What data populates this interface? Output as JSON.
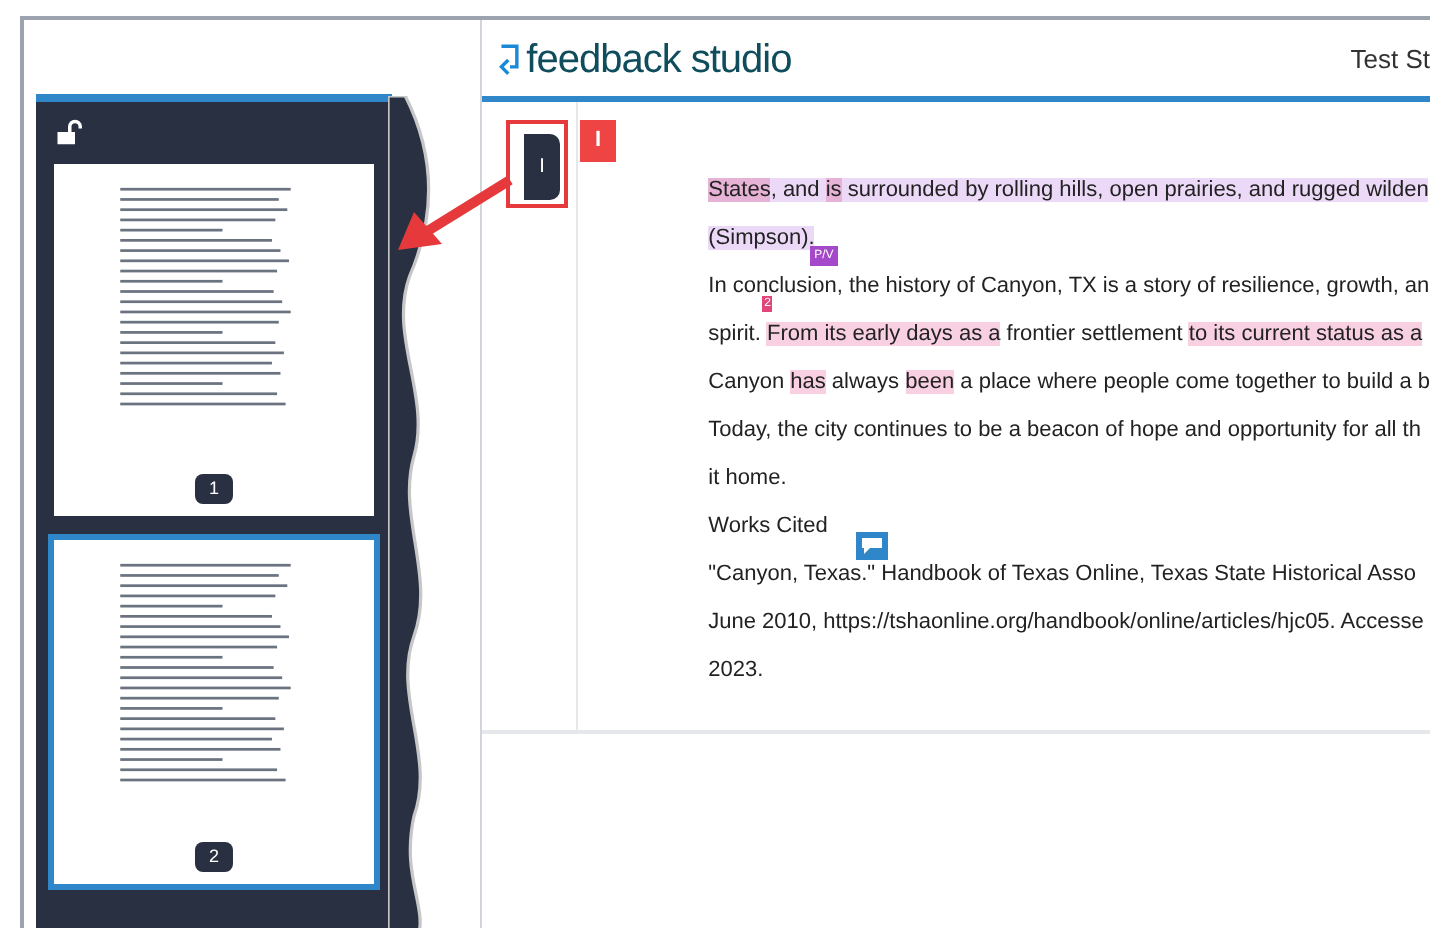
{
  "sidebar": {
    "pages": [
      {
        "label": "1",
        "selected": false
      },
      {
        "label": "2",
        "selected": true
      }
    ]
  },
  "header": {
    "logo": "feedback studio",
    "title": "Test St"
  },
  "handle": {
    "label": "I"
  },
  "callout": {
    "label": "I"
  },
  "document": {
    "lines": [
      {
        "segments": [
          {
            "text": "States",
            "color": "#e6b3d6"
          },
          {
            "text": ", and ",
            "color": "#ecd9f7"
          },
          {
            "text": "is",
            "color": "#e6b3d6"
          },
          {
            "text": " surrounded by rolling hills, open prairies, and rugged wilden",
            "color": "#ecd9f7"
          }
        ]
      },
      {
        "segments": [
          {
            "text": "(Simpson).",
            "color": "#ecd9f7"
          }
        ],
        "tag": {
          "text": "P/V"
        }
      },
      {
        "segments": [
          {
            "text": "In conclusion, the history of Canyon, TX is a story of resilience, growth, an"
          }
        ]
      },
      {
        "segments": [
          {
            "text": "spirit. "
          },
          {
            "text": "From its early days as a",
            "color": "#f8d0e2"
          },
          {
            "text": " frontier settlement "
          },
          {
            "text": "to its current status as a",
            "color": "#f8d0e2"
          }
        ],
        "marker": {
          "text": "2"
        }
      },
      {
        "segments": [
          {
            "text": "Canyon "
          },
          {
            "text": "has",
            "color": "#f8d0e2"
          },
          {
            "text": " always "
          },
          {
            "text": "been",
            "color": "#f8d0e2"
          },
          {
            "text": " a place where people come together to build a b"
          }
        ]
      },
      {
        "segments": [
          {
            "text": "Today, the city continues to be a beacon of hope and opportunity for all th"
          }
        ]
      },
      {
        "segments": [
          {
            "text": "it home."
          }
        ]
      },
      {
        "segments": [
          {
            "text": "Works Cited"
          }
        ]
      },
      {
        "segments": [
          {
            "text": "\"Canyon, Texas.\" Handbook of Texas Online, Texas State Historical Asso"
          }
        ],
        "comment": true
      },
      {
        "segments": [
          {
            "text": "June 2010, https://tshaonline.org/handbook/online/articles/hjc05. Accesse"
          }
        ]
      },
      {
        "segments": [
          {
            "text": "2023."
          }
        ]
      }
    ]
  }
}
